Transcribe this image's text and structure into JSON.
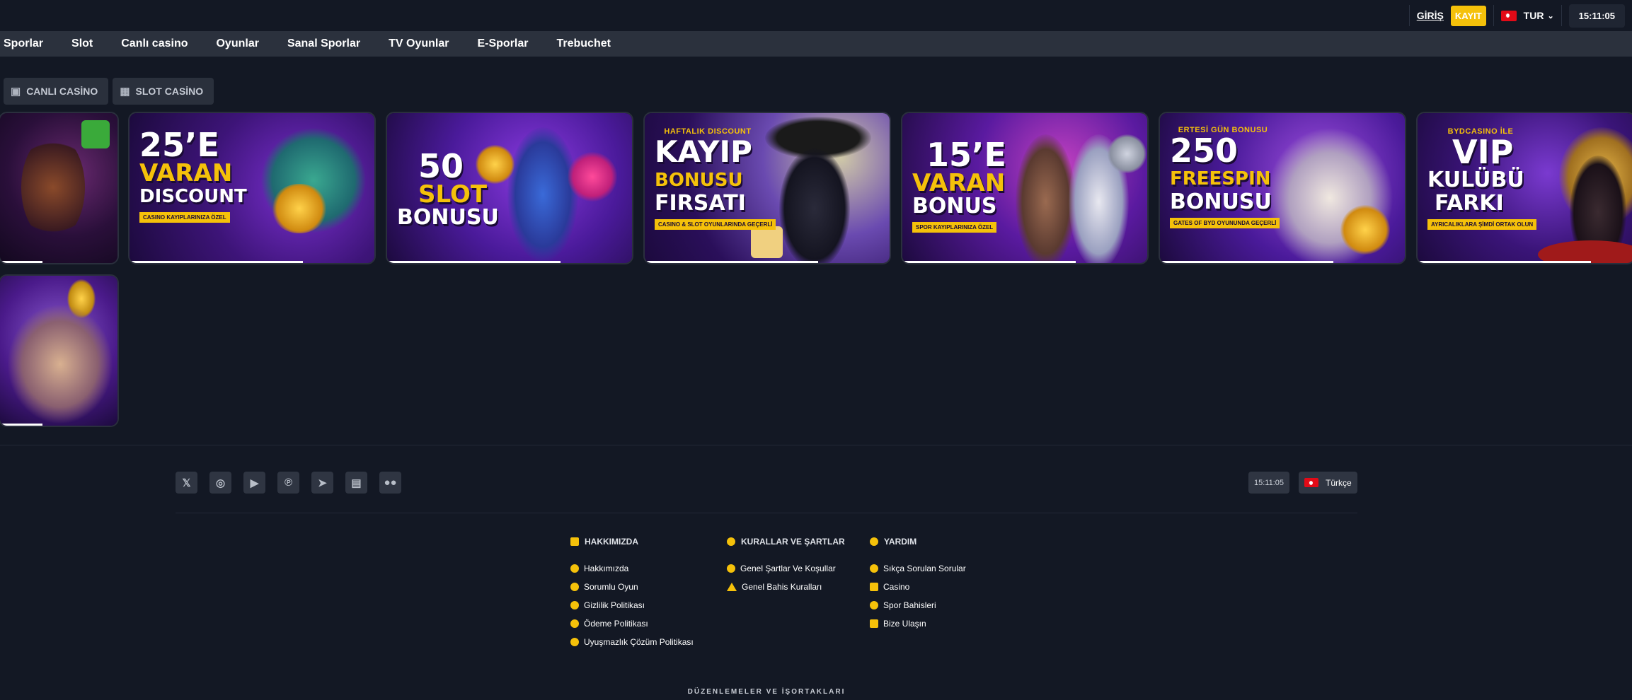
{
  "header": {
    "login_label": "GİRİŞ",
    "register_label": "KAYIT",
    "currency": "TUR",
    "clock": "15:11:05"
  },
  "nav": {
    "items": [
      "Sporlar",
      "Slot",
      "Canlı casino",
      "Oyunlar",
      "Sanal Sporlar",
      "TV Oyunlar",
      "E-Sporlar",
      "Trebuchet"
    ]
  },
  "filters": {
    "live_casino": "CANLI CASİNO",
    "slot_casino": "SLOT CASİNO"
  },
  "promos": [
    {
      "top": "",
      "l1": "",
      "l2": "",
      "l3": "",
      "chip": ""
    },
    {
      "top": "",
      "l1": "25’E",
      "l2": "VARAN",
      "l3": "DISCOUNT",
      "chip": "CASINO KAYIPLARINIZA ÖZEL"
    },
    {
      "top": "",
      "l1": "50",
      "l2": "SLOT",
      "l3": "BONUSU",
      "chip": ""
    },
    {
      "top": "HAFTALIK DISCOUNT",
      "l1": "KAYIP",
      "l2": "BONUSU",
      "l3": "FIRSATI",
      "chip": "CASINO & SLOT OYUNLARINDA GEÇERLİ"
    },
    {
      "top": "",
      "l1": "15’E",
      "l2": "VARAN",
      "l3": "BONUS",
      "chip": "SPOR KAYIPLARINIZA ÖZEL"
    },
    {
      "top": "ERTESİ GÜN BONUSU",
      "l1": "250",
      "l2": "FREESPIN",
      "l3": "BONUSU",
      "chip": "GATES OF BYD OYUNUNDA GEÇERLİ"
    },
    {
      "top": "BYDCASINO İLE",
      "l1": "VIP",
      "l2": "KULÜBÜ",
      "l3": "FARKI",
      "chip": "AYRICALIKLARA ŞİMDİ ORTAK OLUN"
    },
    {
      "top": "",
      "l1": "",
      "l2": "",
      "l3": "",
      "chip": ""
    }
  ],
  "footer": {
    "social": [
      "x-icon",
      "instagram-icon",
      "youtube-icon",
      "pinterest-icon",
      "telegram-icon",
      "twitch-icon",
      "medium-icon"
    ],
    "clock": "15:11:05",
    "language": "Türkçe",
    "about": {
      "title": "HAKKIMIZDA",
      "items": [
        "Hakkımızda",
        "Sorumlu Oyun",
        "Gizlilik Politikası",
        "Ödeme Politikası",
        "Uyuşmazlık Çözüm Politikası"
      ]
    },
    "rules": {
      "title": "KURALLAR VE ŞARTLAR",
      "items": [
        "Genel Şartlar Ve Koşullar",
        "Genel Bahis Kuralları"
      ]
    },
    "help": {
      "title": "YARDIM",
      "items": [
        "Sıkça Sorulan Sorular",
        "Casino",
        "Spor Bahisleri",
        "Bize Ulaşın"
      ]
    },
    "regulations": "DÜZENLEMELER VE İŞORTAKLARI"
  },
  "colors": {
    "accent": "#f5c10a",
    "background": "#131824",
    "nav_bg": "#2b313d"
  }
}
